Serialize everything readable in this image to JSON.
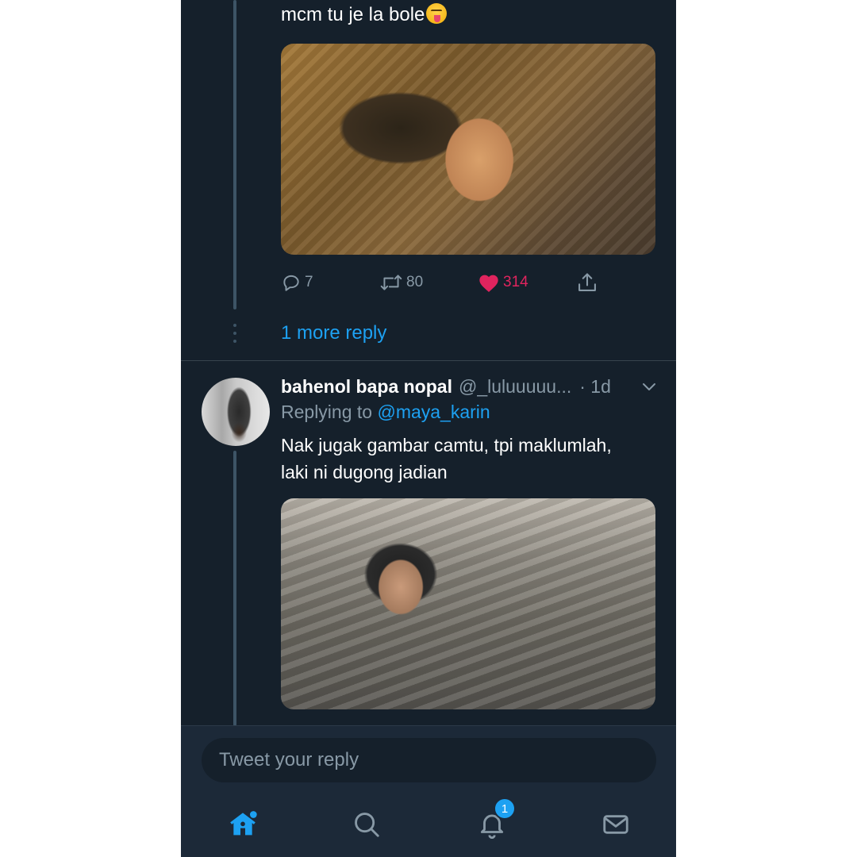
{
  "thread": {
    "partial_text": "mcm tu je la bole",
    "partial_emoji": "squinting-face-with-tongue-icon",
    "actions": {
      "reply_count": "7",
      "retweet_count": "80",
      "like_count": "314"
    },
    "more_reply": "1 more reply"
  },
  "tweet": {
    "name": "bahenol bapa nopal",
    "handle": "@_luluuuuu...",
    "time": "· 1d",
    "replying_prefix": "Replying to",
    "replying_to": "@maya_karin",
    "body_line1": "Nak jugak gambar camtu, tpi maklumlah,",
    "body_line2": "laki ni dugong jadian"
  },
  "compose": {
    "placeholder": "Tweet your reply"
  },
  "tabbar": {
    "notification_badge": "1"
  },
  "colors": {
    "background": "#15202b",
    "accent": "#1da1f2",
    "like": "#e0245e",
    "muted": "#8899a6"
  }
}
